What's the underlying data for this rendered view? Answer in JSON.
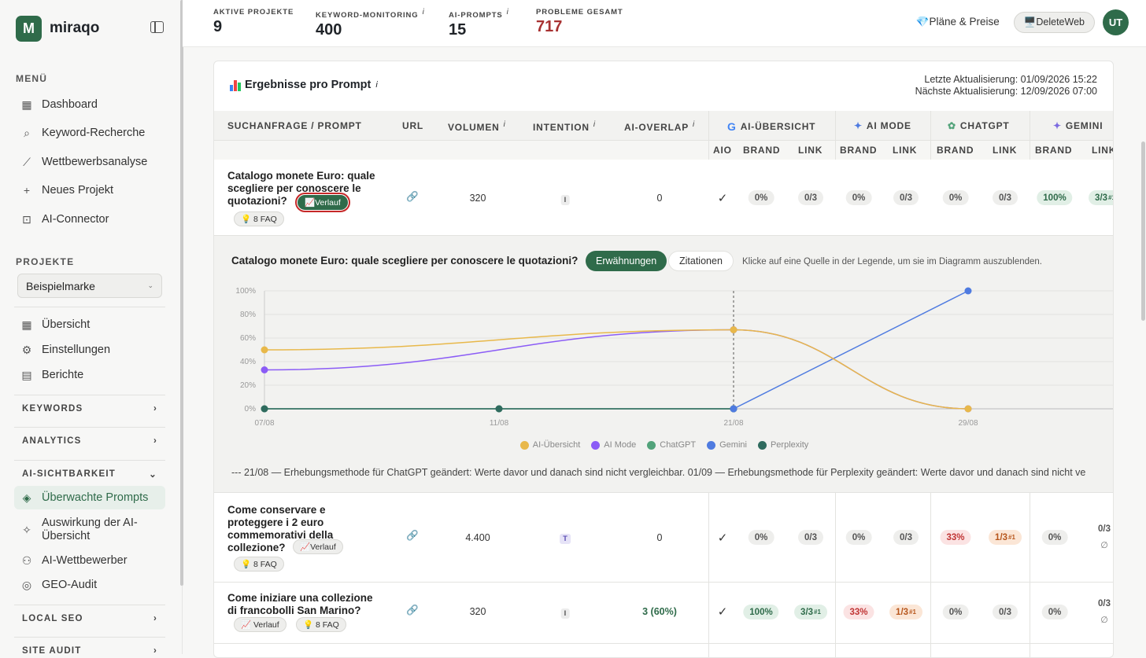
{
  "brand": {
    "logo_letter": "M",
    "name": "miraqo"
  },
  "sidebar": {
    "menu_label": "MENÜ",
    "menu": [
      {
        "label": "Dashboard",
        "icon": "grid-icon"
      },
      {
        "label": "Keyword-Recherche",
        "icon": "search-icon"
      },
      {
        "label": "Wettbewerbsanalyse",
        "icon": "chart-line-icon"
      },
      {
        "label": "Neues Projekt",
        "icon": "plus-icon"
      },
      {
        "label": "AI-Connector",
        "icon": "robot-icon"
      }
    ],
    "projects_label": "PROJEKTE",
    "project_select": "Beispielmarke",
    "project_nav": [
      {
        "label": "Übersicht",
        "icon": "grid-icon"
      },
      {
        "label": "Einstellungen",
        "icon": "gear-icon"
      },
      {
        "label": "Berichte",
        "icon": "document-icon"
      }
    ],
    "groups": {
      "keywords": "KEYWORDS",
      "analytics": "ANALYTICS",
      "ai_visibility": "AI-SICHTBARKEIT",
      "local_seo": "LOCAL SEO",
      "site_audit": "SITE AUDIT"
    },
    "ai_items": [
      {
        "label": "Überwachte Prompts",
        "icon": "layers-icon",
        "active": true
      },
      {
        "label": "Auswirkung der AI-Übersicht",
        "icon": "sparkle-icon"
      },
      {
        "label": "AI-Wettbewerber",
        "icon": "users-icon"
      },
      {
        "label": "GEO-Audit",
        "icon": "compass-icon"
      }
    ]
  },
  "topbar": {
    "stats": [
      {
        "label": "AKTIVE PROJEKTE",
        "value": "9",
        "info": ""
      },
      {
        "label": "KEYWORD-MONITORING",
        "value": "400",
        "info": "i"
      },
      {
        "label": "AI-PROMPTS",
        "value": "15",
        "info": "i"
      },
      {
        "label": "PROBLEME GESAMT",
        "value": "717",
        "info": ""
      }
    ],
    "plans": "💎Pläne & Preise",
    "delete_web": "🖥️DeleteWeb",
    "avatar": "UT",
    "problems_color": "#a83232"
  },
  "card": {
    "title": "Ergebnisse pro Prompt",
    "title_info": "i",
    "last_update": "Letzte Aktualisierung: 01/09/2026 15:22",
    "next_update": "Nächste Aktualisierung: 12/09/2026 07:00"
  },
  "table": {
    "headers": {
      "query": "SUCHANFRAGE / PROMPT",
      "url": "URL",
      "volume": "VOLUMEN",
      "intent": "INTENTION",
      "overlap": "AI-OVERLAP",
      "aio": "AI-ÜBERSICHT",
      "aimode": "AI MODE",
      "chatgpt": "CHATGPT",
      "gemini": "GEMINI"
    },
    "info": "i",
    "sub": {
      "aio": "AIO",
      "brand": "BRAND",
      "link": "LINK",
      "link_cut": "LINK"
    },
    "rows": [
      {
        "query": "Catalogo monete Euro: quale scegliere per conoscere le quotazioni?",
        "verlauf": "📈Verlauf",
        "faq": "💡 8 FAQ",
        "volume": "320",
        "intent": "I",
        "overlap": "0",
        "aio": "✓",
        "aio_brand": "0%",
        "aio_link": "0/3",
        "aim_brand": "0%",
        "aim_link": "0/3",
        "gpt_brand": "0%",
        "gpt_link": "0/3",
        "gem_brand": "100%",
        "gem_link": "3/3",
        "gem_sup": "#1"
      },
      {
        "query": "Come conservare e proteggere i 2 euro commemorativi della collezione?",
        "verlauf": "📈Verlauf",
        "faq": "💡 8 FAQ",
        "volume": "4.400",
        "intent": "T",
        "overlap": "0",
        "aio": "✓",
        "aio_brand": "0%",
        "aio_link": "0/3",
        "aim_brand": "0%",
        "aim_link": "0/3",
        "gpt_brand": "33%",
        "gpt_link": "1/3",
        "gpt_sup": "#1",
        "gem_brand": "0%",
        "gem_link": "0/3",
        "gem_extra": "∅"
      },
      {
        "query": "Come iniziare una collezione di francobolli San Marino?",
        "verlauf": "📈 Verlauf",
        "faq": "💡 8 FAQ",
        "volume": "320",
        "intent": "I",
        "overlap": "3 (60%)",
        "aio": "✓",
        "aio_brand": "100%",
        "aio_link": "3/3",
        "aio_sup": "#1",
        "aim_brand": "33%",
        "aim_link": "1/3",
        "aim_sup": "#1",
        "gpt_brand": "0%",
        "gpt_link": "0/3",
        "gem_brand": "0%",
        "gem_link": "0/3",
        "gem_extra": "∅"
      }
    ]
  },
  "detail": {
    "title": "Catalogo monete Euro: quale scegliere per conoscere le quotazioni?",
    "tab_on": "Erwähnungen",
    "tab_off": "Zitationen",
    "hint": "Klicke auf eine Quelle in der Legende, um sie im Diagramm auszublenden.",
    "note": "--- 21/08 — Erhebungsmethode für ChatGPT geändert: Werte davor und danach sind nicht vergleichbar. 01/09 — Erhebungsmethode für Perplexity geändert: Werte davor und danach sind nicht ve"
  },
  "chart_data": {
    "type": "line",
    "x": [
      "07/08",
      "11/08",
      "21/08",
      "29/08"
    ],
    "y_ticks": [
      "0%",
      "20%",
      "40%",
      "60%",
      "80%",
      "100%"
    ],
    "ylim": [
      0,
      100
    ],
    "marker_x": "21/08",
    "series": [
      {
        "name": "AI-Übersicht",
        "color": "#e8b84a",
        "values": [
          50,
          null,
          67,
          0
        ]
      },
      {
        "name": "AI Mode",
        "color": "#8b5cf6",
        "values": [
          33,
          null,
          67,
          0
        ]
      },
      {
        "name": "ChatGPT",
        "color": "#52a37a",
        "values": [
          0,
          0,
          0,
          null
        ]
      },
      {
        "name": "Gemini",
        "color": "#4f7be0",
        "values": [
          null,
          null,
          0,
          100
        ]
      },
      {
        "name": "Perplexity",
        "color": "#2f6b5e",
        "values": [
          0,
          0,
          0,
          null
        ]
      }
    ],
    "legend_position": "bottom"
  }
}
